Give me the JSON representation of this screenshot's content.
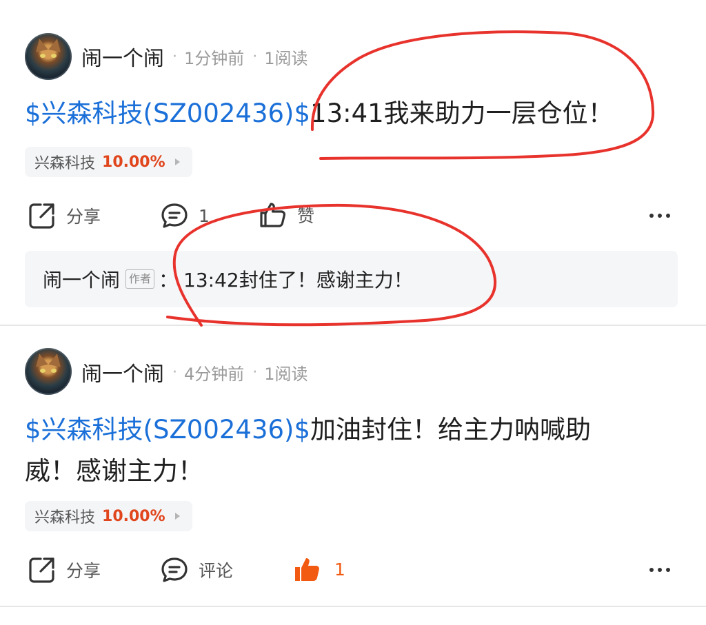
{
  "posts": [
    {
      "author": "闹一个闹",
      "time": "1分钟前",
      "reads": "1阅读",
      "stock_link": "$兴森科技(SZ002436)$",
      "body": "13:41我来助力一层仓位！",
      "tag": {
        "name": "兴森科技",
        "change": "10.00%"
      },
      "actions": {
        "share": "分享",
        "comment": "1",
        "like": "赞"
      },
      "reply": {
        "name": "闹一个闹",
        "badge": "作者",
        "colon": "：",
        "text": "13:42封住了！感谢主力！"
      }
    },
    {
      "author": "闹一个闹",
      "time": "4分钟前",
      "reads": "1阅读",
      "stock_link": "$兴森科技(SZ002436)$",
      "body_line1": "加油封住！给主力呐喊助",
      "body_line2": "威！感谢主力！",
      "tag": {
        "name": "兴森科技",
        "change": "10.00%"
      },
      "actions": {
        "share": "分享",
        "comment": "评论",
        "like": "1"
      }
    }
  ],
  "icons": {
    "separator": "·",
    "share": "share-icon",
    "comment": "comment-icon",
    "like": "thumbs-up-icon",
    "like_active": "thumbs-up-filled-icon",
    "more": "more-dots-icon"
  },
  "colors": {
    "stock_link": "#1a6fd8",
    "change_up": "#e0451c",
    "like_active": "#f25a12",
    "annotation": "#e8322c"
  }
}
